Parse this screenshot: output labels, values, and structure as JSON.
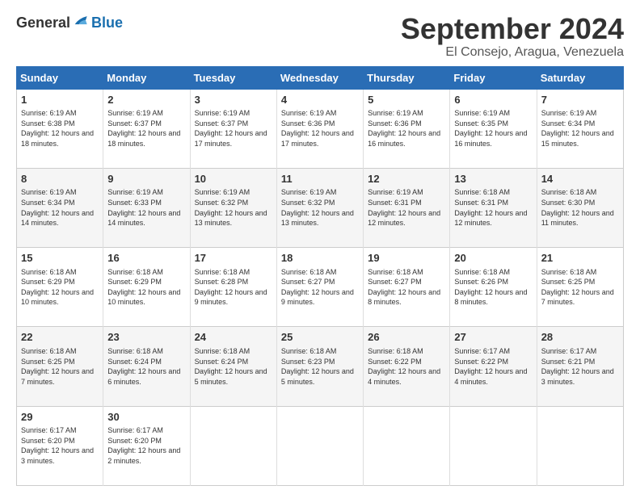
{
  "logo": {
    "general": "General",
    "blue": "Blue"
  },
  "header": {
    "month": "September 2024",
    "location": "El Consejo, Aragua, Venezuela"
  },
  "days": [
    "Sunday",
    "Monday",
    "Tuesday",
    "Wednesday",
    "Thursday",
    "Friday",
    "Saturday"
  ],
  "weeks": [
    [
      {
        "day": 1,
        "sunrise": "6:19 AM",
        "sunset": "6:38 PM",
        "daylight": "12 hours and 18 minutes."
      },
      {
        "day": 2,
        "sunrise": "6:19 AM",
        "sunset": "6:37 PM",
        "daylight": "12 hours and 18 minutes."
      },
      {
        "day": 3,
        "sunrise": "6:19 AM",
        "sunset": "6:37 PM",
        "daylight": "12 hours and 17 minutes."
      },
      {
        "day": 4,
        "sunrise": "6:19 AM",
        "sunset": "6:36 PM",
        "daylight": "12 hours and 17 minutes."
      },
      {
        "day": 5,
        "sunrise": "6:19 AM",
        "sunset": "6:36 PM",
        "daylight": "12 hours and 16 minutes."
      },
      {
        "day": 6,
        "sunrise": "6:19 AM",
        "sunset": "6:35 PM",
        "daylight": "12 hours and 16 minutes."
      },
      {
        "day": 7,
        "sunrise": "6:19 AM",
        "sunset": "6:34 PM",
        "daylight": "12 hours and 15 minutes."
      }
    ],
    [
      {
        "day": 8,
        "sunrise": "6:19 AM",
        "sunset": "6:34 PM",
        "daylight": "12 hours and 14 minutes."
      },
      {
        "day": 9,
        "sunrise": "6:19 AM",
        "sunset": "6:33 PM",
        "daylight": "12 hours and 14 minutes."
      },
      {
        "day": 10,
        "sunrise": "6:19 AM",
        "sunset": "6:32 PM",
        "daylight": "12 hours and 13 minutes."
      },
      {
        "day": 11,
        "sunrise": "6:19 AM",
        "sunset": "6:32 PM",
        "daylight": "12 hours and 13 minutes."
      },
      {
        "day": 12,
        "sunrise": "6:19 AM",
        "sunset": "6:31 PM",
        "daylight": "12 hours and 12 minutes."
      },
      {
        "day": 13,
        "sunrise": "6:18 AM",
        "sunset": "6:31 PM",
        "daylight": "12 hours and 12 minutes."
      },
      {
        "day": 14,
        "sunrise": "6:18 AM",
        "sunset": "6:30 PM",
        "daylight": "12 hours and 11 minutes."
      }
    ],
    [
      {
        "day": 15,
        "sunrise": "6:18 AM",
        "sunset": "6:29 PM",
        "daylight": "12 hours and 10 minutes."
      },
      {
        "day": 16,
        "sunrise": "6:18 AM",
        "sunset": "6:29 PM",
        "daylight": "12 hours and 10 minutes."
      },
      {
        "day": 17,
        "sunrise": "6:18 AM",
        "sunset": "6:28 PM",
        "daylight": "12 hours and 9 minutes."
      },
      {
        "day": 18,
        "sunrise": "6:18 AM",
        "sunset": "6:27 PM",
        "daylight": "12 hours and 9 minutes."
      },
      {
        "day": 19,
        "sunrise": "6:18 AM",
        "sunset": "6:27 PM",
        "daylight": "12 hours and 8 minutes."
      },
      {
        "day": 20,
        "sunrise": "6:18 AM",
        "sunset": "6:26 PM",
        "daylight": "12 hours and 8 minutes."
      },
      {
        "day": 21,
        "sunrise": "6:18 AM",
        "sunset": "6:25 PM",
        "daylight": "12 hours and 7 minutes."
      }
    ],
    [
      {
        "day": 22,
        "sunrise": "6:18 AM",
        "sunset": "6:25 PM",
        "daylight": "12 hours and 7 minutes."
      },
      {
        "day": 23,
        "sunrise": "6:18 AM",
        "sunset": "6:24 PM",
        "daylight": "12 hours and 6 minutes."
      },
      {
        "day": 24,
        "sunrise": "6:18 AM",
        "sunset": "6:24 PM",
        "daylight": "12 hours and 5 minutes."
      },
      {
        "day": 25,
        "sunrise": "6:18 AM",
        "sunset": "6:23 PM",
        "daylight": "12 hours and 5 minutes."
      },
      {
        "day": 26,
        "sunrise": "6:18 AM",
        "sunset": "6:22 PM",
        "daylight": "12 hours and 4 minutes."
      },
      {
        "day": 27,
        "sunrise": "6:17 AM",
        "sunset": "6:22 PM",
        "daylight": "12 hours and 4 minutes."
      },
      {
        "day": 28,
        "sunrise": "6:17 AM",
        "sunset": "6:21 PM",
        "daylight": "12 hours and 3 minutes."
      }
    ],
    [
      {
        "day": 29,
        "sunrise": "6:17 AM",
        "sunset": "6:20 PM",
        "daylight": "12 hours and 3 minutes."
      },
      {
        "day": 30,
        "sunrise": "6:17 AM",
        "sunset": "6:20 PM",
        "daylight": "12 hours and 2 minutes."
      },
      null,
      null,
      null,
      null,
      null
    ]
  ]
}
